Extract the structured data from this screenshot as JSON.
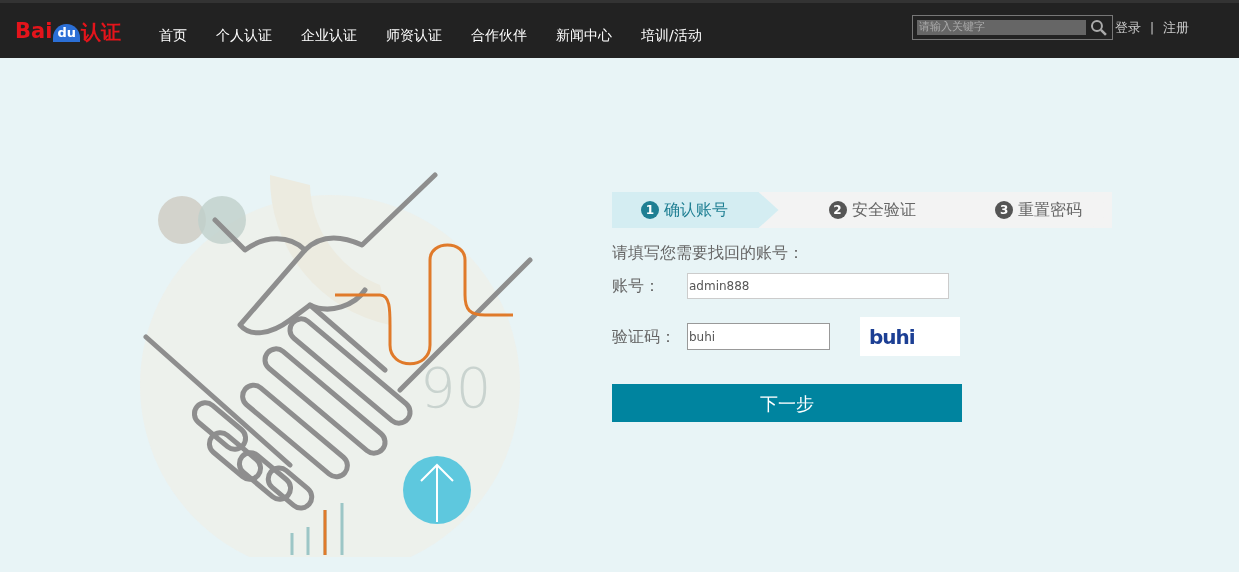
{
  "header": {
    "logo": {
      "part_1": "Bai",
      "part_2": "du",
      "part_3": "认证"
    },
    "nav": [
      {
        "label": "首页"
      },
      {
        "label": "个人认证"
      },
      {
        "label": "企业认证"
      },
      {
        "label": "师资认证"
      },
      {
        "label": "合作伙伴"
      },
      {
        "label": "新闻中心"
      },
      {
        "label": "培训/活动"
      }
    ],
    "search": {
      "placeholder": "请输入关键字"
    },
    "login": "登录",
    "separator": "|",
    "register": "注册"
  },
  "illustration": {
    "text": "90"
  },
  "steps": [
    {
      "number": "1",
      "label": "确认账号",
      "selected": true
    },
    {
      "number": "2",
      "label": "安全验证",
      "selected": false
    },
    {
      "number": "3",
      "label": "重置密码",
      "selected": false
    }
  ],
  "form": {
    "prompt": "请填写您需要找回的账号：",
    "account": {
      "label": "账号：",
      "value": "admin888"
    },
    "captcha": {
      "label": "验证码：",
      "value": "buhi",
      "image_text": "buhi"
    },
    "submit": "下一步"
  }
}
